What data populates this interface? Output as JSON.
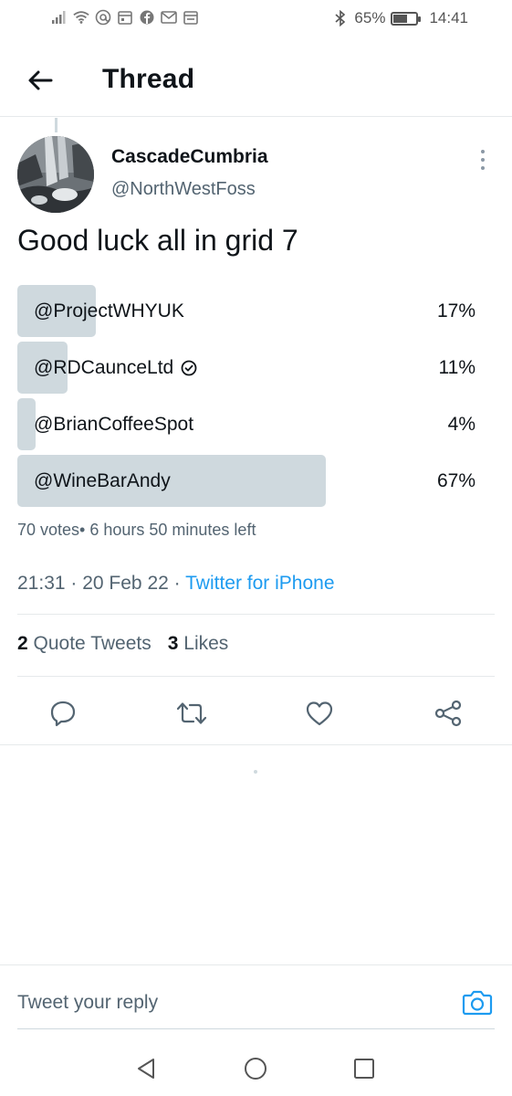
{
  "status_bar": {
    "battery_percent": "65%",
    "battery_level": 0.65,
    "time": "14:41",
    "icons": [
      "signal-icon",
      "wifi-icon",
      "at-icon",
      "calendar-icon",
      "facebook-icon",
      "mail-icon",
      "calendar-icon",
      "bluetooth-icon",
      "battery-icon"
    ]
  },
  "header": {
    "title": "Thread",
    "back_icon": "arrow-left-icon"
  },
  "tweet": {
    "display_name": "CascadeCumbria",
    "handle": "@NorthWestFoss",
    "text": "Good luck all in grid 7",
    "poll": {
      "options": [
        {
          "label": "@ProjectWHYUK",
          "percent_label": "17%",
          "percent": 17,
          "verified": false
        },
        {
          "label": "@RDCaunceLtd",
          "percent_label": "11%",
          "percent": 11,
          "verified": true
        },
        {
          "label": "@BrianCoffeeSpot",
          "percent_label": "4%",
          "percent": 4,
          "verified": false
        },
        {
          "label": "@WineBarAndy",
          "percent_label": "67%",
          "percent": 67,
          "verified": false
        }
      ],
      "meta": "70 votes• 6 hours 50 minutes left"
    },
    "time": "21:31",
    "date": "20 Feb 22",
    "source": "Twitter for iPhone",
    "quote_tweets_count": "2",
    "quote_tweets_label": "Quote Tweets",
    "likes_count": "3",
    "likes_label": "Likes"
  },
  "reply": {
    "placeholder": "Tweet your reply"
  },
  "colors": {
    "accent": "#1d9bf0",
    "poll_bar": "#cfd9de",
    "muted_text": "#536471"
  }
}
